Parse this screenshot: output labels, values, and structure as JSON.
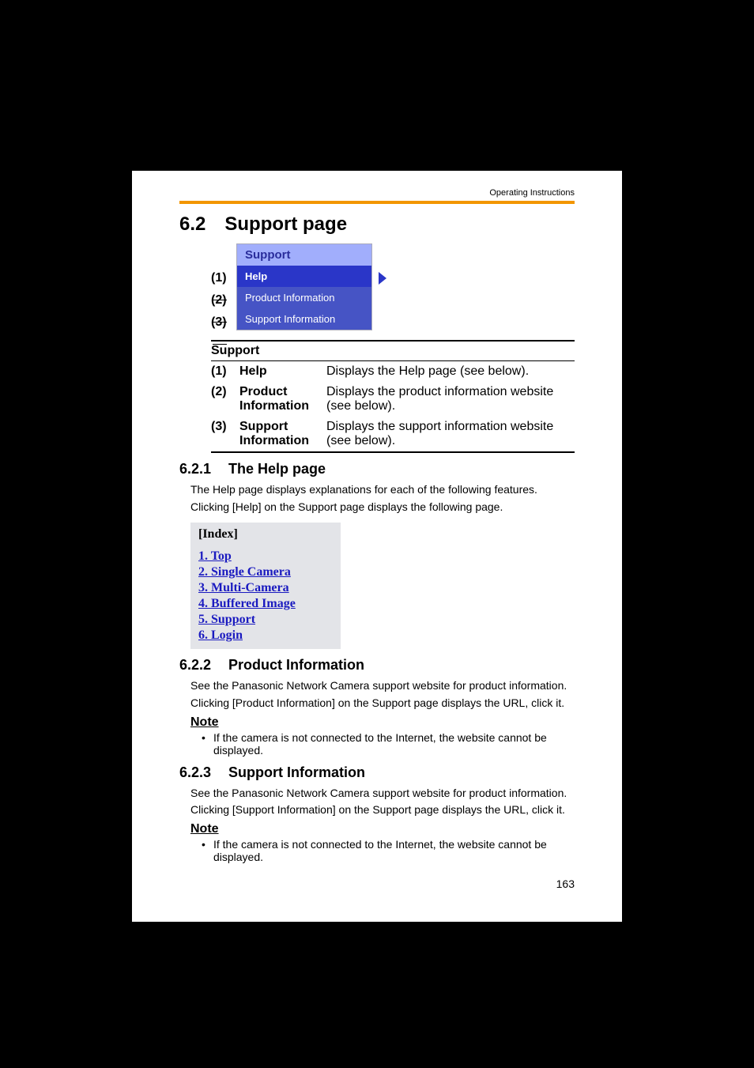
{
  "header": {
    "running": "Operating Instructions"
  },
  "h1": {
    "num": "6.2",
    "text": "Support page"
  },
  "menu": {
    "title": "Support",
    "labels": [
      "(1)",
      "(2)",
      "(3)"
    ],
    "items": [
      {
        "text": "Help",
        "selected": true
      },
      {
        "text": "Product Information",
        "selected": false
      },
      {
        "text": "Support Information",
        "selected": false
      }
    ]
  },
  "table": {
    "heading": "Support",
    "rows": [
      {
        "n": "(1)",
        "name": "Help",
        "desc": "Displays the Help page (see below)."
      },
      {
        "n": "(2)",
        "name": "Product Information",
        "desc": "Displays the product information website (see below)."
      },
      {
        "n": "(3)",
        "name": "Support Information",
        "desc": "Displays the support information website (see below)."
      }
    ]
  },
  "s1": {
    "num": "6.2.1",
    "title": "The Help page",
    "p1": "The Help page displays explanations for each of the following features.",
    "p2": "Clicking [Help] on the Support page displays the following page.",
    "index_title": "[Index]",
    "index_items": [
      "1. Top",
      "2. Single Camera",
      "3. Multi-Camera",
      "4. Buffered Image",
      "5. Support",
      "6. Login"
    ]
  },
  "s2": {
    "num": "6.2.2",
    "title": "Product Information",
    "p1": "See the Panasonic Network Camera support website for product information.",
    "p2": "Clicking [Product Information] on the Support page displays the URL, click it.",
    "note": "Note",
    "bullet": "If the camera is not connected to the Internet, the website cannot be displayed."
  },
  "s3": {
    "num": "6.2.3",
    "title": "Support Information",
    "p1": "See the Panasonic Network Camera support website for product information.",
    "p2": "Clicking [Support Information] on the Support page displays the URL, click it.",
    "note": "Note",
    "bullet": "If the camera is not connected to the Internet, the website cannot be displayed."
  },
  "page_number": "163"
}
